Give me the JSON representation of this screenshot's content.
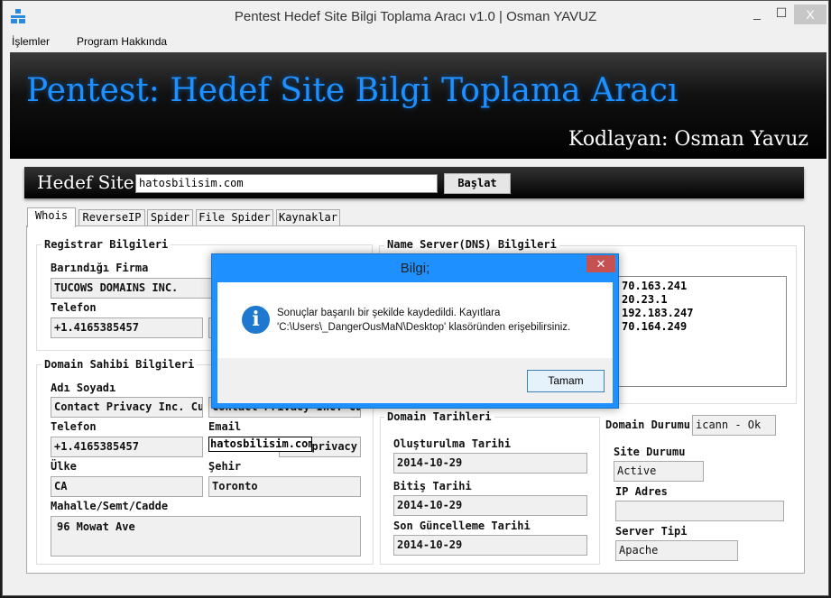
{
  "window": {
    "title": "Pentest Hedef Site Bilgi Toplama Aracı v1.0 | Osman YAVUZ",
    "minimize": "_",
    "maximize": "☐",
    "close": "X"
  },
  "menu": [
    "İşlemler",
    "Program Hakkında"
  ],
  "header": {
    "title": "Pentest: Hedef Site Bilgi Toplama Aracı",
    "subtitle": "Kodlayan: Osman Yavuz"
  },
  "target": {
    "label": "Hedef Site:",
    "value": "hatosbilisim.com",
    "start": "Başlat"
  },
  "tabs": [
    "Whois",
    "ReverseIP",
    "Spider",
    "File Spider",
    "Kaynaklar"
  ],
  "registrar": {
    "title": "Registrar Bilgileri",
    "firm_label": "Barındığı Firma",
    "firm": "TUCOWS DOMAINS INC.",
    "phone_label": "Telefon",
    "phone": "+1.4165385457"
  },
  "owner": {
    "title": "Domain Sahibi Bilgileri",
    "name_label": "Adı Soyadı",
    "name": "Contact Privacy Inc. Customer",
    "company": "Contact Privacy Inc. Customer",
    "phone_label": "Telefon",
    "phone": "+1.4165385457",
    "email_label": "Email",
    "email_popup": "hatosbilisim.com",
    "email": "contactprivacy",
    "country_label": "Ülke",
    "country": "CA",
    "city_label": "Şehir",
    "city": "Toronto",
    "address_label": "Mahalle/Semt/Cadde",
    "address": "96 Mowat Ave"
  },
  "nameservers": {
    "title": "Name Server(DNS) Bilgileri",
    "items": [
      "70.163.241",
      "20.23.1",
      "192.183.247",
      "70.164.249"
    ]
  },
  "dates": {
    "title": "Domain Tarihleri",
    "created_label": "Oluşturulma Tarihi",
    "created": "2014-10-29",
    "expires_label": "Bitiş Tarihi",
    "expires": "2014-10-29",
    "updated_label": "Son Güncelleme Tarihi",
    "updated": "2014-10-29"
  },
  "status": {
    "domain_label": "Domain Durumu",
    "domain": "icann - Ok",
    "site_label": "Site Durumu",
    "site": "Active",
    "ip_label": "IP Adres",
    "ip": "",
    "server_label": "Server Tipi",
    "server": "Apache"
  },
  "dialog": {
    "title": "Bilgi;",
    "line1": "Sonuçlar başarılı bir şekilde kaydedildi. Kayıtlara",
    "line2": "'C:\\Users\\_DangerOusMaN\\Desktop' klasöründen erişebilirsiniz.",
    "ok": "Tamam",
    "icon": "info-icon",
    "accent": "#1e90ff"
  }
}
